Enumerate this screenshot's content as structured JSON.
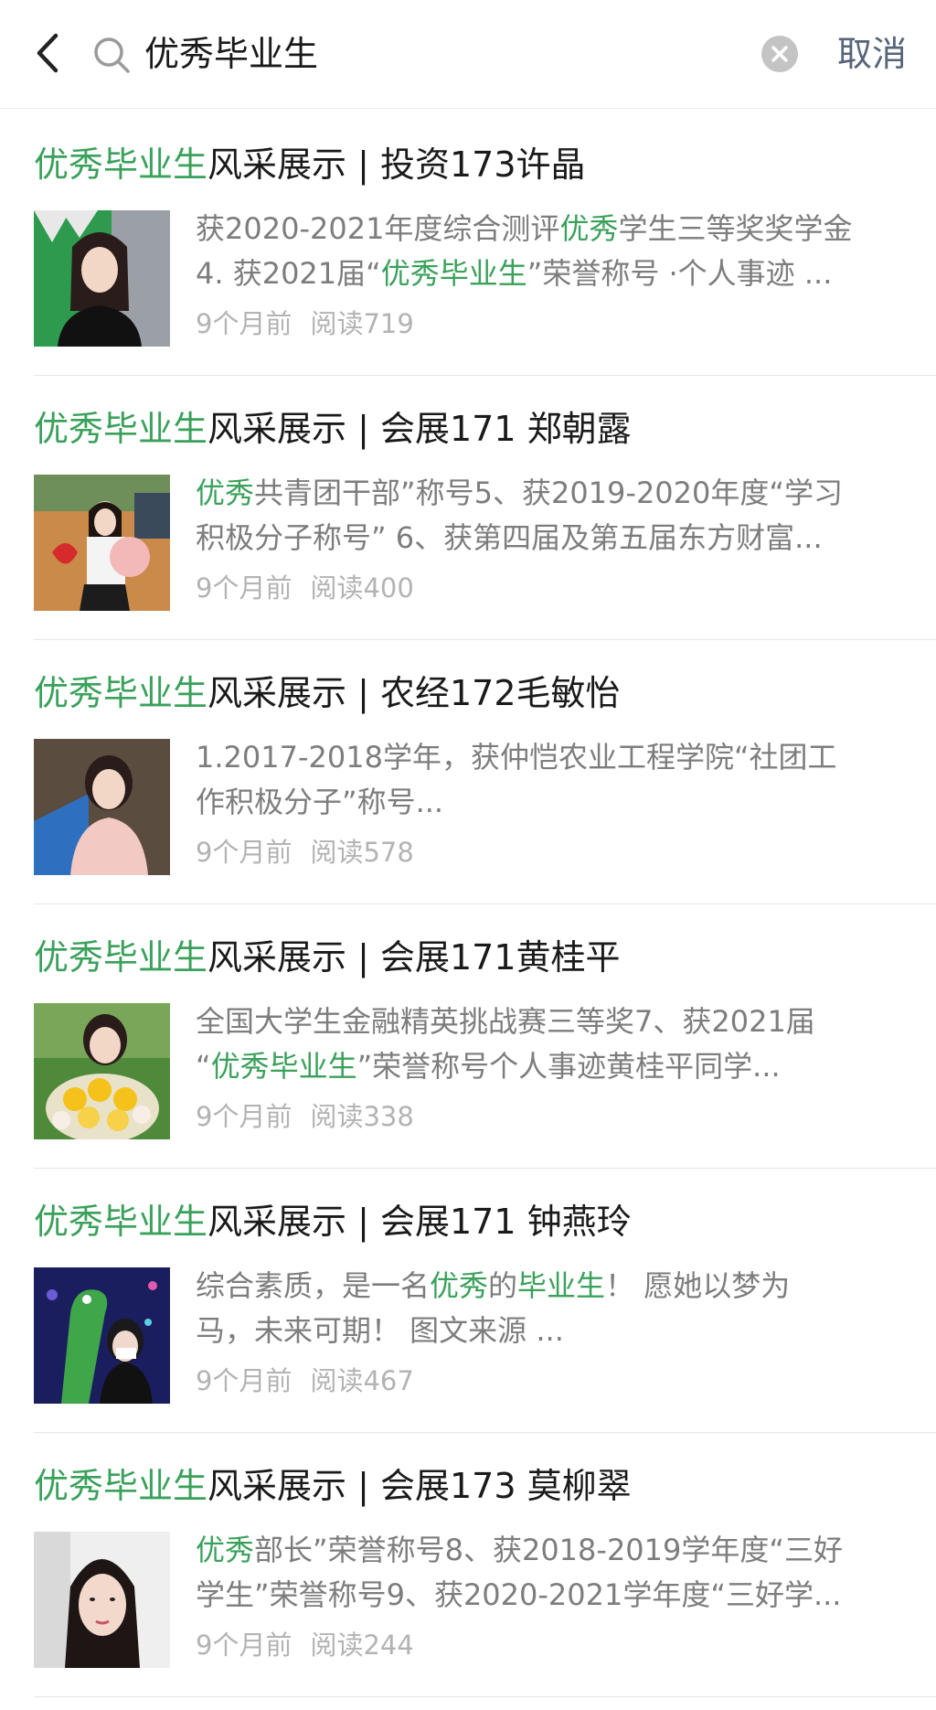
{
  "search": {
    "query": "优秀毕业生",
    "cancel_label": "取消"
  },
  "colors": {
    "highlight": "#3aa15b",
    "cancel": "#56657a",
    "meta": "#b3b3b3"
  },
  "icons": {
    "back": "chevron-left-icon",
    "search": "search-icon",
    "clear": "clear-icon"
  },
  "results": [
    {
      "title_hl": "优秀毕业生",
      "title_rest": "风采展示 | 投资173许晶",
      "snippet_line1": [
        {
          "t": "获2020-2021年度综合测评"
        },
        {
          "t": "优秀",
          "hl": true
        },
        {
          "t": "学生三等奖奖学金"
        }
      ],
      "snippet_line2": [
        {
          "t": "4. 获2021届“"
        },
        {
          "t": "优秀毕业生",
          "hl": true
        },
        {
          "t": "”荣誉称号 ·个人事迹 ..."
        }
      ],
      "time": "9个月前",
      "reads": "阅读719"
    },
    {
      "title_hl": "优秀毕业生",
      "title_rest": "风采展示 | 会展171 郑朝露",
      "snippet_line1": [
        {
          "t": "优秀",
          "hl": true
        },
        {
          "t": "共青团干部”称号5、获2019-2020年度“学习"
        }
      ],
      "snippet_line2": [
        {
          "t": "积极分子称号” 6、获第四届及第五届东方财富..."
        }
      ],
      "time": "9个月前",
      "reads": "阅读400"
    },
    {
      "title_hl": "优秀毕业生",
      "title_rest": "风采展示 | 农经172毛敏怡",
      "snippet_line1": [
        {
          "t": "1.2017-2018学年，获仲恺农业工程学院“社团工"
        }
      ],
      "snippet_line2": [
        {
          "t": "作积极分子”称号..."
        }
      ],
      "time": "9个月前",
      "reads": "阅读578"
    },
    {
      "title_hl": "优秀毕业生",
      "title_rest": "风采展示 | 会展171黄桂平",
      "snippet_line1": [
        {
          "t": "全国大学生金融精英挑战赛三等奖7、获2021届"
        }
      ],
      "snippet_line2": [
        {
          "t": "“"
        },
        {
          "t": "优秀毕业生",
          "hl": true
        },
        {
          "t": "”荣誉称号个人事迹黄桂平同学..."
        }
      ],
      "time": "9个月前",
      "reads": "阅读338"
    },
    {
      "title_hl": "优秀毕业生",
      "title_rest": "风采展示 | 会展171 钟燕玲",
      "snippet_line1": [
        {
          "t": "综合素质，是一名"
        },
        {
          "t": "优秀",
          "hl": true
        },
        {
          "t": "的"
        },
        {
          "t": "毕业生",
          "hl": true
        },
        {
          "t": "！ 愿她以梦为"
        }
      ],
      "snippet_line2": [
        {
          "t": "马，未来可期！ 图文来源 ..."
        }
      ],
      "time": "9个月前",
      "reads": "阅读467"
    },
    {
      "title_hl": "优秀毕业生",
      "title_rest": "风采展示 | 会展173 莫柳翠",
      "snippet_line1": [
        {
          "t": "优秀",
          "hl": true
        },
        {
          "t": "部长”荣誉称号8、获2018-2019学年度“三好"
        }
      ],
      "snippet_line2": [
        {
          "t": "学生”荣誉称号9、获2020-2021学年度“三好学..."
        }
      ],
      "time": "9个月前",
      "reads": "阅读244"
    }
  ]
}
